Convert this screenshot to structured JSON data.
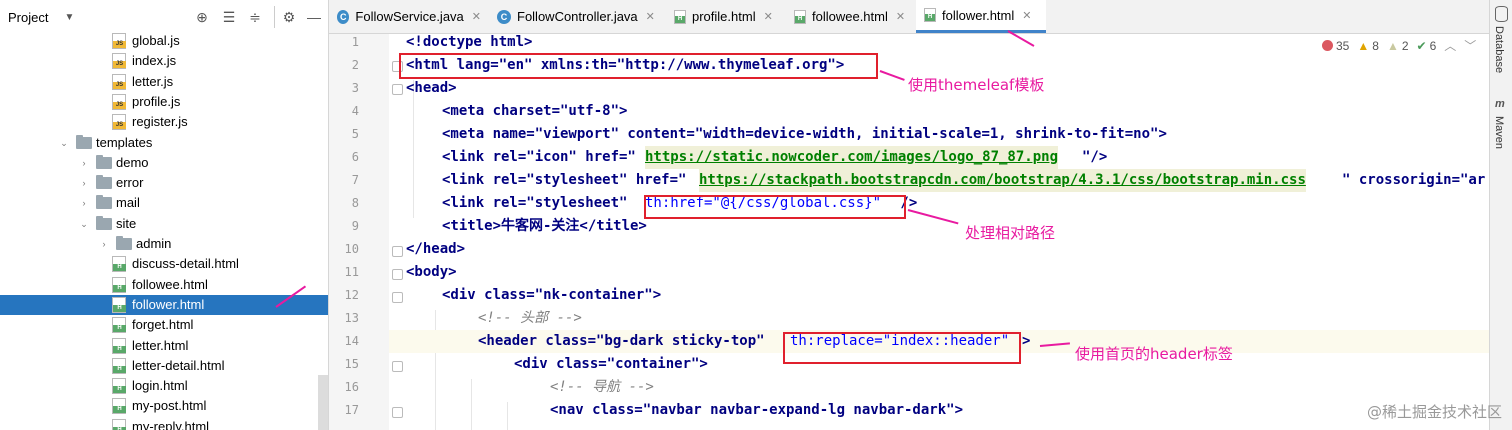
{
  "project_panel": {
    "title": "Project",
    "tree": [
      {
        "label": "global.js",
        "kind": "js",
        "indent": 2
      },
      {
        "label": "index.js",
        "kind": "js",
        "indent": 2
      },
      {
        "label": "letter.js",
        "kind": "js",
        "indent": 2
      },
      {
        "label": "profile.js",
        "kind": "js",
        "indent": 2
      },
      {
        "label": "register.js",
        "kind": "js",
        "indent": 2
      },
      {
        "label": "templates",
        "kind": "folder",
        "indent": 0,
        "open": true
      },
      {
        "label": "demo",
        "kind": "folder",
        "indent": 1
      },
      {
        "label": "error",
        "kind": "folder",
        "indent": 1
      },
      {
        "label": "mail",
        "kind": "folder",
        "indent": 1
      },
      {
        "label": "site",
        "kind": "folder",
        "indent": 1,
        "open": true
      },
      {
        "label": "admin",
        "kind": "folder",
        "indent": 2
      },
      {
        "label": "discuss-detail.html",
        "kind": "html",
        "indent": 2
      },
      {
        "label": "followee.html",
        "kind": "html",
        "indent": 2
      },
      {
        "label": "follower.html",
        "kind": "html",
        "indent": 2,
        "selected": true
      },
      {
        "label": "forget.html",
        "kind": "html",
        "indent": 2
      },
      {
        "label": "letter.html",
        "kind": "html",
        "indent": 2
      },
      {
        "label": "letter-detail.html",
        "kind": "html",
        "indent": 2
      },
      {
        "label": "login.html",
        "kind": "html",
        "indent": 2
      },
      {
        "label": "my-post.html",
        "kind": "html",
        "indent": 2
      },
      {
        "label": "my-reply.html",
        "kind": "html",
        "indent": 2
      }
    ]
  },
  "tabs": [
    {
      "label": "FollowService.java",
      "kind": "java"
    },
    {
      "label": "FollowController.java",
      "kind": "java"
    },
    {
      "label": "profile.html",
      "kind": "html"
    },
    {
      "label": "followee.html",
      "kind": "html"
    },
    {
      "label": "follower.html",
      "kind": "html",
      "active": true
    }
  ],
  "inspections": {
    "errors": "35",
    "warnings": "8",
    "weak": "2",
    "typos": "6"
  },
  "line_numbers": [
    "1",
    "2",
    "3",
    "4",
    "5",
    "6",
    "7",
    "8",
    "9",
    "10",
    "11",
    "12",
    "13",
    "14",
    "15",
    "16",
    "17"
  ],
  "code": {
    "l1": "<!doctype html>",
    "l2": "<html lang=\"en\" xmlns:th=\"http://www.thymeleaf.org\">",
    "l3": "<head>",
    "l4": "<meta charset=\"utf-8\">",
    "l5": "<meta name=\"viewport\" content=\"width=device-width, initial-scale=1, shrink-to-fit=no\">",
    "l6a": "<link rel=\"icon\" href=\"",
    "l6b": "https://static.nowcoder.com/images/logo_87_87.png",
    "l6c": "\"/>",
    "l7a": "<link rel=\"stylesheet\" href=\"",
    "l7b": "https://stackpath.bootstrapcdn.com/bootstrap/4.3.1/css/bootstrap.min.css",
    "l7c": "\" crossorigin=\"ar",
    "l8a": "<link rel=\"stylesheet\" ",
    "l8b": "th:href=\"@{/css/global.css}\"",
    "l8c": " />",
    "l9": "<title>牛客网-关注</title>",
    "l10": "</head>",
    "l11": "<body>",
    "l12": "<div class=\"nk-container\">",
    "l13": "<!-- 头部 -->",
    "l14a": "<header class=\"bg-dark sticky-top\" ",
    "l14b": "th:replace=\"index::header\"",
    "l14c": ">",
    "l15": "<div class=\"container\">",
    "l16": "<!-- 导航 -->",
    "l17": "<nav class=\"navbar navbar-expand-lg navbar-dark\">"
  },
  "annotations": {
    "a1": "使用themeleaf模板",
    "a2": "处理相对路径",
    "a3": "使用首页的header标签"
  },
  "sidebar_right": {
    "database": "Database",
    "maven": "Maven"
  },
  "watermark": "@稀土掘金技术社区"
}
